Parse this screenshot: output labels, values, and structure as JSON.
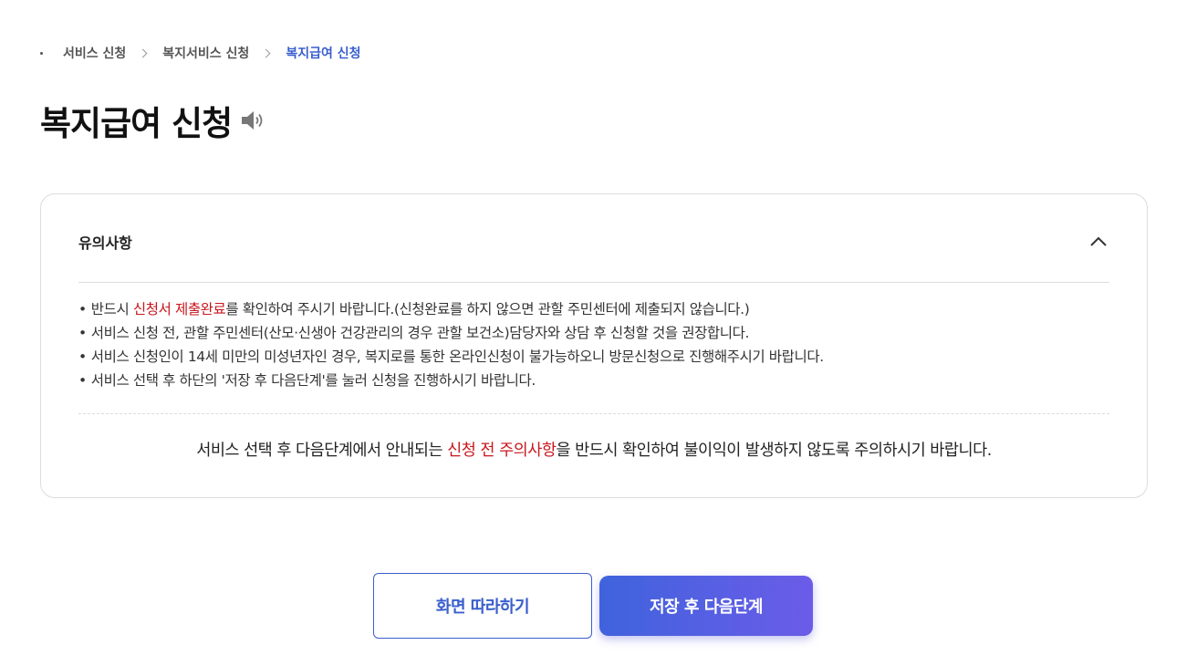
{
  "breadcrumb": {
    "items": [
      "서비스 신청",
      "복지서비스 신청"
    ],
    "current": "복지급여 신청"
  },
  "page": {
    "title": "복지급여 신청",
    "speaker_icon": "speaker-icon"
  },
  "notice": {
    "title": "유의사항",
    "toggle_icon": "chevron-up-icon",
    "items": [
      {
        "pre": "반드시 ",
        "highlight": "신청서 제출완료",
        "post": "를 확인하여 주시기 바랍니다.(신청완료를 하지 않으면 관할 주민센터에 제출되지 않습니다.)"
      },
      {
        "text": "서비스 신청 전, 관할 주민센터(산모·신생아 건강관리의 경우 관할 보건소)담당자와 상담 후 신청할 것을 권장합니다."
      },
      {
        "text": "서비스 신청인이 14세 미만의 미성년자인 경우, 복지로를 통한 온라인신청이 불가능하오니 방문신청으로 진행해주시기 바랍니다."
      },
      {
        "text": "서비스 선택 후 하단의 '저장 후 다음단계'를 눌러 신청을 진행하시기 바랍니다."
      }
    ],
    "bottom": {
      "pre": "서비스 선택 후 다음단계에서 안내되는 ",
      "highlight": "신청 전 주의사항",
      "post": "을 반드시 확인하여 불이익이 발생하지 않도록 주의하시기 바랍니다."
    },
    "highlight_color": "#c8161d"
  },
  "buttons": {
    "secondary": "화면 따라하기",
    "primary": "저장 후 다음단계"
  },
  "colors": {
    "accent": "#3a5fcd",
    "primary_gradient_start": "#3f63dd",
    "primary_gradient_end": "#6b5ce8"
  }
}
